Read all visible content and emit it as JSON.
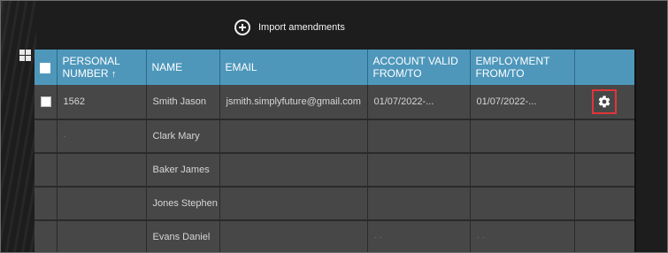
{
  "toolbar": {
    "import_label": "Import amendments",
    "import_icon": "plus-circle-icon"
  },
  "table": {
    "columns": [
      {
        "key": "select",
        "label": ""
      },
      {
        "key": "personal_number",
        "label": "PERSONAL NUMBER",
        "sort": "↑"
      },
      {
        "key": "name",
        "label": "NAME"
      },
      {
        "key": "email",
        "label": "EMAIL"
      },
      {
        "key": "account_valid",
        "label": "ACCOUNT VALID FROM/TO"
      },
      {
        "key": "employment",
        "label": "EMPLOYMENT FROM/TO"
      },
      {
        "key": "actions",
        "label": ""
      }
    ],
    "rows": [
      {
        "personal_number": "1562",
        "name": "Smith Jason",
        "email": "jsmith.simplyfuture@gmail.com",
        "account_valid": "01/07/2022-...",
        "employment": "01/07/2022-...",
        "actions_icon": "gear-icon"
      },
      {
        "personal_number": "·",
        "name": "Clark Mary",
        "email": "",
        "account_valid": "",
        "employment": ""
      },
      {
        "personal_number": "",
        "name": "Baker James",
        "email": "",
        "account_valid": "",
        "employment": ""
      },
      {
        "personal_number": "",
        "name": "Jones Stephen",
        "email": "",
        "account_valid": "",
        "employment": ""
      },
      {
        "personal_number": "",
        "name": "Evans Daniel",
        "email": "",
        "account_valid": "·  ·",
        "employment": "·  ·"
      }
    ]
  },
  "colors": {
    "header_bg": "#4e97bb",
    "row_bg": "#474747",
    "highlight_border": "#e0353b"
  }
}
